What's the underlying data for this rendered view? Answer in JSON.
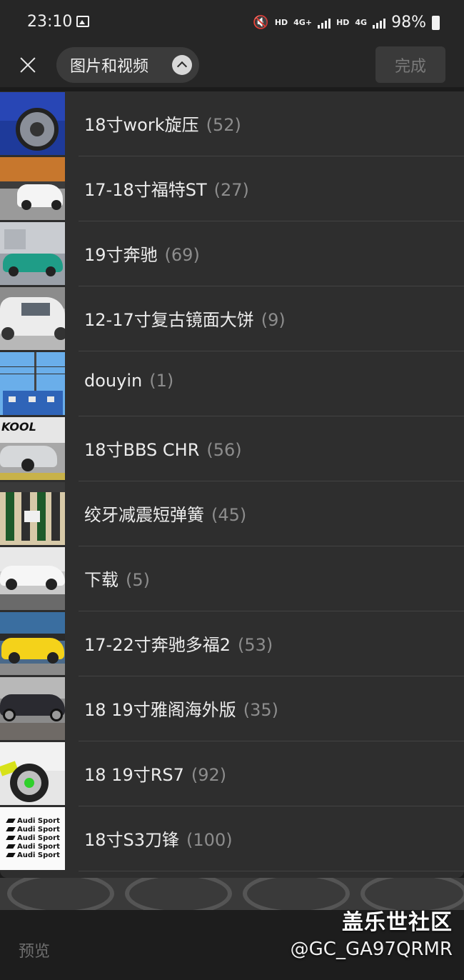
{
  "status_bar": {
    "time": "23:10",
    "net1": "HD",
    "net2": "4G+",
    "net3": "HD",
    "net4": "4G",
    "battery": "98%"
  },
  "header": {
    "album_selector_label": "图片和视频",
    "done_label": "完成"
  },
  "albums": [
    {
      "name": "18寸work旋压",
      "count": "(52)"
    },
    {
      "name": "17-18寸福特ST",
      "count": "(27)"
    },
    {
      "name": "19寸奔驰",
      "count": "(69)"
    },
    {
      "name": "12-17寸复古镜面大饼",
      "count": "(9)"
    },
    {
      "name": "douyin",
      "count": "(1)"
    },
    {
      "name": "18寸BBS CHR",
      "count": "(56)"
    },
    {
      "name": "绞牙减震短弹簧",
      "count": "(45)"
    },
    {
      "name": "下载",
      "count": "(5)"
    },
    {
      "name": "17-22寸奔驰多福2",
      "count": "(53)"
    },
    {
      "name": "18 19寸雅阁海外版",
      "count": "(35)"
    },
    {
      "name": "18 19寸RS7",
      "count": "(92)"
    },
    {
      "name": "18寸S3刀锋",
      "count": "(100)"
    }
  ],
  "thumbnails": {
    "audi_lines": [
      "Audi Sport",
      "Audi Sport",
      "Audi Sport",
      "Audi Sport",
      "Audi Sport"
    ],
    "kool_text": "KOOL"
  },
  "bottom_bar": {
    "preview_label": "预览"
  },
  "watermark": {
    "title": "盖乐世社区",
    "handle": "@GC_GA97QRMR"
  }
}
